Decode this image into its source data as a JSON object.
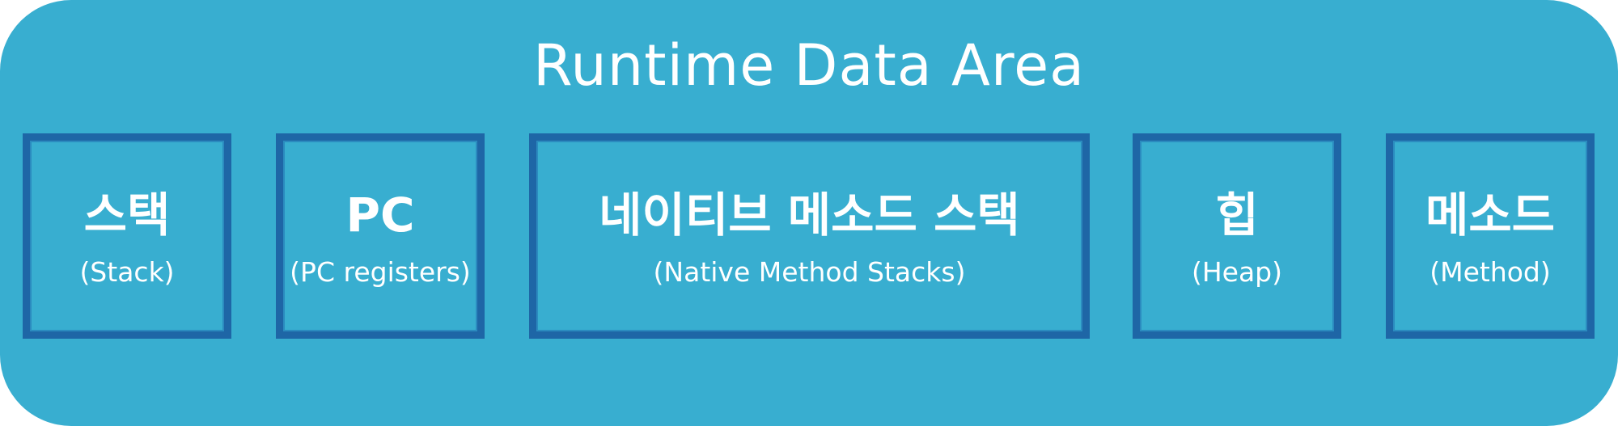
{
  "title": "Runtime Data Area",
  "colors": {
    "panel_fill": "#38aed0",
    "box_border": "#1e66a6",
    "text": "#ffffff"
  },
  "areas": [
    {
      "label": "스택",
      "sublabel": "(Stack)"
    },
    {
      "label": "PC",
      "sublabel": "(PC registers)"
    },
    {
      "label": "네이티브 메소드 스택",
      "sublabel": "(Native Method Stacks)"
    },
    {
      "label": "힙",
      "sublabel": "(Heap)"
    },
    {
      "label": "메소드",
      "sublabel": "(Method)"
    }
  ]
}
